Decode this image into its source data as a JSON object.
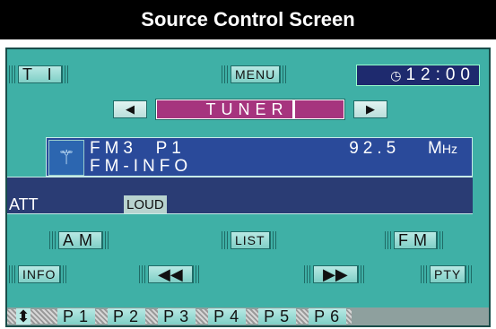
{
  "header": {
    "title": "Source Control Screen"
  },
  "top_bar": {
    "ti_label": "T I",
    "menu_label": "MENU",
    "clock": "12:00"
  },
  "source": {
    "prev_glyph": "◀",
    "label": "TUNER",
    "next_glyph": "▶"
  },
  "info": {
    "band": "FM3",
    "preset": "P1",
    "frequency": "92.5",
    "unit_m": "M",
    "unit_hz": "Hz",
    "line2": "FM-INFO"
  },
  "status": {
    "att": "ATT",
    "loud": "LOUD"
  },
  "controls": {
    "am": "AM",
    "list": "LIST",
    "fm": "FM",
    "info": "INFO",
    "seek_back_glyph": "◀◀",
    "seek_fwd_glyph": "▶▶",
    "pty": "PTY"
  },
  "presets": [
    "P1",
    "P2",
    "P3",
    "P4",
    "P5",
    "P6"
  ],
  "preset_scroll_glyph": "⬍"
}
